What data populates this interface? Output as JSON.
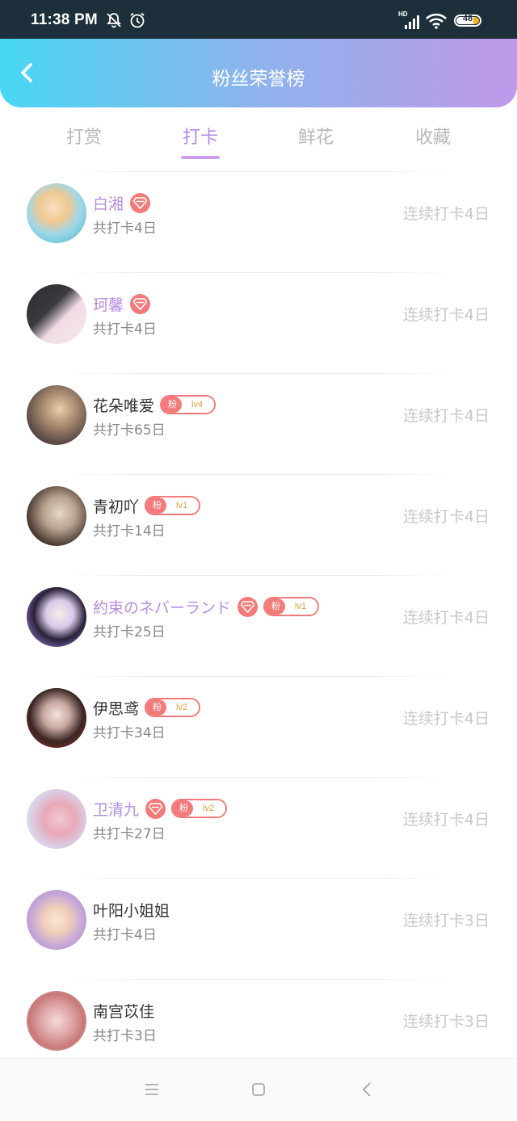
{
  "status_bar": {
    "time": "11:38 PM",
    "icons": [
      "mute-bell-icon",
      "alarm-icon",
      "signal-hd-icon",
      "wifi-icon",
      "battery-icon"
    ],
    "hd_label": "HD",
    "battery_level": "48"
  },
  "header": {
    "title": "粉丝荣誉榜",
    "back_icon": "chevron-left-icon"
  },
  "tabs": [
    {
      "label": "打赏",
      "active": false
    },
    {
      "label": "打卡",
      "active": true
    },
    {
      "label": "鲜花",
      "active": false
    },
    {
      "label": "收藏",
      "active": false
    }
  ],
  "colors": {
    "accent": "#b48be6",
    "badge_red": "#f27a7a",
    "header_gradient": [
      "#48d7f2",
      "#bf99ea"
    ]
  },
  "fan_badge_label": "粉",
  "list": [
    {
      "name": "白湘",
      "vip_diamond": true,
      "fan_level": "",
      "total": "共打卡4日",
      "streak": "连续打卡4日"
    },
    {
      "name": "珂馨",
      "vip_diamond": true,
      "fan_level": "",
      "total": "共打卡4日",
      "streak": "连续打卡4日"
    },
    {
      "name": "花朵唯爱",
      "vip_diamond": false,
      "fan_level": "lv4",
      "total": "共打卡65日",
      "streak": "连续打卡4日"
    },
    {
      "name": "青初吖",
      "vip_diamond": false,
      "fan_level": "lv1",
      "total": "共打卡14日",
      "streak": "连续打卡4日"
    },
    {
      "name": "約束のネバーランド",
      "vip_diamond": true,
      "fan_level": "lv1",
      "total": "共打卡25日",
      "streak": "连续打卡4日"
    },
    {
      "name": "伊思鸢",
      "vip_diamond": false,
      "fan_level": "lv2",
      "total": "共打卡34日",
      "streak": "连续打卡4日"
    },
    {
      "name": "卫清九",
      "vip_diamond": true,
      "fan_level": "lv2",
      "total": "共打卡27日",
      "streak": "连续打卡4日"
    },
    {
      "name": "叶阳小姐姐",
      "vip_diamond": false,
      "fan_level": "",
      "total": "共打卡4日",
      "streak": "连续打卡3日"
    },
    {
      "name": "南宫苡佳",
      "vip_diamond": false,
      "fan_level": "",
      "total": "共打卡3日",
      "streak": "连续打卡3日"
    }
  ],
  "nav_bar": {
    "icons": [
      "menu-icon",
      "home-square-icon",
      "back-triangle-icon"
    ]
  }
}
